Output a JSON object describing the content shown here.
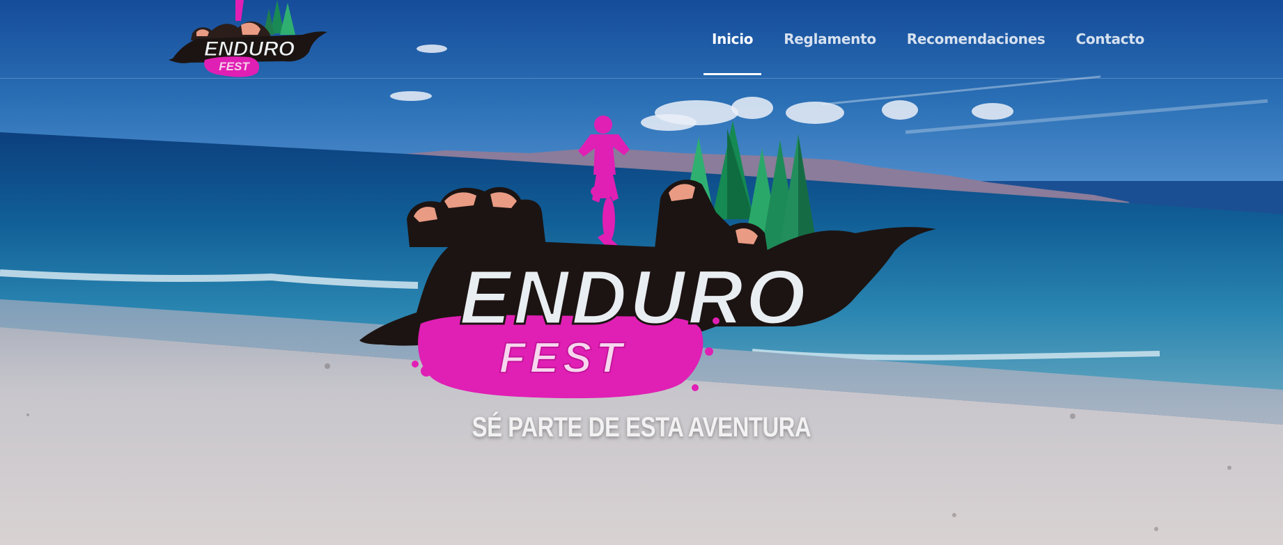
{
  "brand": {
    "name_line1": "ENDURO",
    "name_line2": "FEST"
  },
  "nav": {
    "items": [
      {
        "label": "Inicio",
        "active": true
      },
      {
        "label": "Reglamento",
        "active": false
      },
      {
        "label": "Recomendaciones",
        "active": false
      },
      {
        "label": "Contacto",
        "active": false
      }
    ]
  },
  "hero": {
    "tagline": "SÉ PARTE DE ESTA AVENTURA"
  },
  "colors": {
    "brand_pink": "#e01fb4",
    "rock_salmon": "#e99b84",
    "tree_green": "#1f8f5e",
    "splash_dark": "#1c1412"
  }
}
